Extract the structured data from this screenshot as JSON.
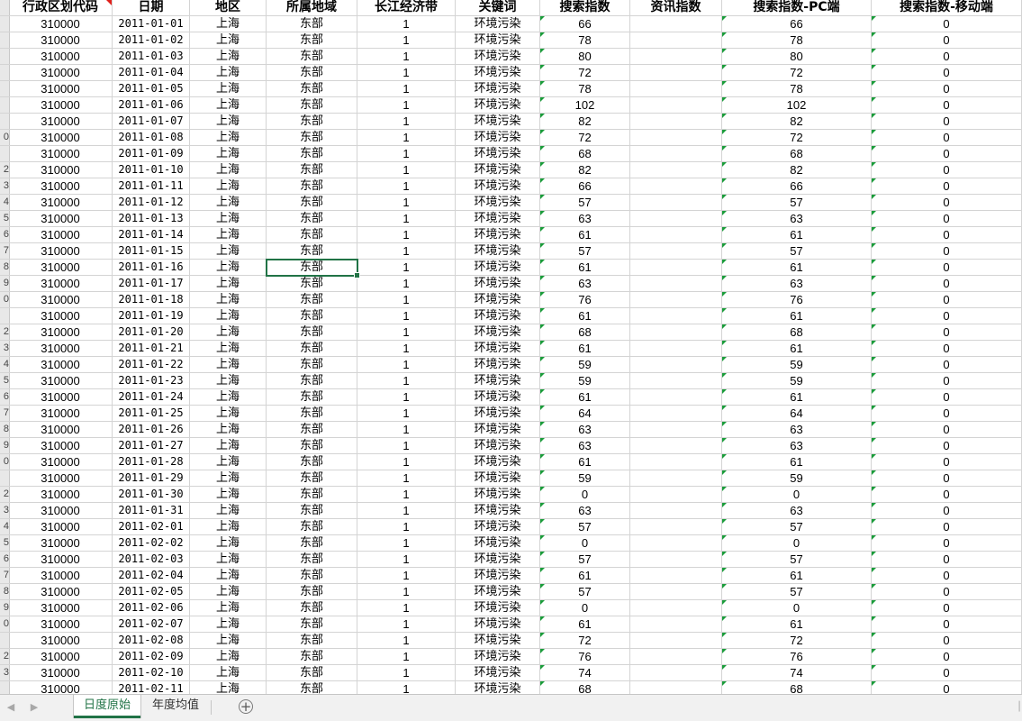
{
  "sheet": {
    "headers": [
      "行政区划代码",
      "日期",
      "地区",
      "所属地域",
      "长江经济带",
      "关键词",
      "搜索指数",
      "资讯指数",
      "搜索指数-PC端",
      "搜索指数-移动端"
    ],
    "row_numbers": [
      "",
      "",
      "",
      "",
      "",
      "",
      "",
      "",
      "0",
      "",
      "2",
      "3",
      "4",
      "5",
      "6",
      "7",
      "8",
      "9",
      "0",
      "",
      "2",
      "3",
      "4",
      "5",
      "6",
      "7",
      "8",
      "9",
      "0",
      "",
      "2",
      "3",
      "4",
      "5",
      "6",
      "7",
      "8",
      "9",
      "0",
      "",
      "2",
      "3"
    ],
    "rows": [
      [
        "310000",
        "2011-01-01",
        "上海",
        "东部",
        "1",
        "环境污染",
        "66",
        "",
        "66",
        "0"
      ],
      [
        "310000",
        "2011-01-02",
        "上海",
        "东部",
        "1",
        "环境污染",
        "78",
        "",
        "78",
        "0"
      ],
      [
        "310000",
        "2011-01-03",
        "上海",
        "东部",
        "1",
        "环境污染",
        "80",
        "",
        "80",
        "0"
      ],
      [
        "310000",
        "2011-01-04",
        "上海",
        "东部",
        "1",
        "环境污染",
        "72",
        "",
        "72",
        "0"
      ],
      [
        "310000",
        "2011-01-05",
        "上海",
        "东部",
        "1",
        "环境污染",
        "78",
        "",
        "78",
        "0"
      ],
      [
        "310000",
        "2011-01-06",
        "上海",
        "东部",
        "1",
        "环境污染",
        "102",
        "",
        "102",
        "0"
      ],
      [
        "310000",
        "2011-01-07",
        "上海",
        "东部",
        "1",
        "环境污染",
        "82",
        "",
        "82",
        "0"
      ],
      [
        "310000",
        "2011-01-08",
        "上海",
        "东部",
        "1",
        "环境污染",
        "72",
        "",
        "72",
        "0"
      ],
      [
        "310000",
        "2011-01-09",
        "上海",
        "东部",
        "1",
        "环境污染",
        "68",
        "",
        "68",
        "0"
      ],
      [
        "310000",
        "2011-01-10",
        "上海",
        "东部",
        "1",
        "环境污染",
        "82",
        "",
        "82",
        "0"
      ],
      [
        "310000",
        "2011-01-11",
        "上海",
        "东部",
        "1",
        "环境污染",
        "66",
        "",
        "66",
        "0"
      ],
      [
        "310000",
        "2011-01-12",
        "上海",
        "东部",
        "1",
        "环境污染",
        "57",
        "",
        "57",
        "0"
      ],
      [
        "310000",
        "2011-01-13",
        "上海",
        "东部",
        "1",
        "环境污染",
        "63",
        "",
        "63",
        "0"
      ],
      [
        "310000",
        "2011-01-14",
        "上海",
        "东部",
        "1",
        "环境污染",
        "61",
        "",
        "61",
        "0"
      ],
      [
        "310000",
        "2011-01-15",
        "上海",
        "东部",
        "1",
        "环境污染",
        "57",
        "",
        "57",
        "0"
      ],
      [
        "310000",
        "2011-01-16",
        "上海",
        "东部",
        "1",
        "环境污染",
        "61",
        "",
        "61",
        "0"
      ],
      [
        "310000",
        "2011-01-17",
        "上海",
        "东部",
        "1",
        "环境污染",
        "63",
        "",
        "63",
        "0"
      ],
      [
        "310000",
        "2011-01-18",
        "上海",
        "东部",
        "1",
        "环境污染",
        "76",
        "",
        "76",
        "0"
      ],
      [
        "310000",
        "2011-01-19",
        "上海",
        "东部",
        "1",
        "环境污染",
        "61",
        "",
        "61",
        "0"
      ],
      [
        "310000",
        "2011-01-20",
        "上海",
        "东部",
        "1",
        "环境污染",
        "68",
        "",
        "68",
        "0"
      ],
      [
        "310000",
        "2011-01-21",
        "上海",
        "东部",
        "1",
        "环境污染",
        "61",
        "",
        "61",
        "0"
      ],
      [
        "310000",
        "2011-01-22",
        "上海",
        "东部",
        "1",
        "环境污染",
        "59",
        "",
        "59",
        "0"
      ],
      [
        "310000",
        "2011-01-23",
        "上海",
        "东部",
        "1",
        "环境污染",
        "59",
        "",
        "59",
        "0"
      ],
      [
        "310000",
        "2011-01-24",
        "上海",
        "东部",
        "1",
        "环境污染",
        "61",
        "",
        "61",
        "0"
      ],
      [
        "310000",
        "2011-01-25",
        "上海",
        "东部",
        "1",
        "环境污染",
        "64",
        "",
        "64",
        "0"
      ],
      [
        "310000",
        "2011-01-26",
        "上海",
        "东部",
        "1",
        "环境污染",
        "63",
        "",
        "63",
        "0"
      ],
      [
        "310000",
        "2011-01-27",
        "上海",
        "东部",
        "1",
        "环境污染",
        "63",
        "",
        "63",
        "0"
      ],
      [
        "310000",
        "2011-01-28",
        "上海",
        "东部",
        "1",
        "环境污染",
        "61",
        "",
        "61",
        "0"
      ],
      [
        "310000",
        "2011-01-29",
        "上海",
        "东部",
        "1",
        "环境污染",
        "59",
        "",
        "59",
        "0"
      ],
      [
        "310000",
        "2011-01-30",
        "上海",
        "东部",
        "1",
        "环境污染",
        "0",
        "",
        "0",
        "0"
      ],
      [
        "310000",
        "2011-01-31",
        "上海",
        "东部",
        "1",
        "环境污染",
        "63",
        "",
        "63",
        "0"
      ],
      [
        "310000",
        "2011-02-01",
        "上海",
        "东部",
        "1",
        "环境污染",
        "57",
        "",
        "57",
        "0"
      ],
      [
        "310000",
        "2011-02-02",
        "上海",
        "东部",
        "1",
        "环境污染",
        "0",
        "",
        "0",
        "0"
      ],
      [
        "310000",
        "2011-02-03",
        "上海",
        "东部",
        "1",
        "环境污染",
        "57",
        "",
        "57",
        "0"
      ],
      [
        "310000",
        "2011-02-04",
        "上海",
        "东部",
        "1",
        "环境污染",
        "61",
        "",
        "61",
        "0"
      ],
      [
        "310000",
        "2011-02-05",
        "上海",
        "东部",
        "1",
        "环境污染",
        "57",
        "",
        "57",
        "0"
      ],
      [
        "310000",
        "2011-02-06",
        "上海",
        "东部",
        "1",
        "环境污染",
        "0",
        "",
        "0",
        "0"
      ],
      [
        "310000",
        "2011-02-07",
        "上海",
        "东部",
        "1",
        "环境污染",
        "61",
        "",
        "61",
        "0"
      ],
      [
        "310000",
        "2011-02-08",
        "上海",
        "东部",
        "1",
        "环境污染",
        "72",
        "",
        "72",
        "0"
      ],
      [
        "310000",
        "2011-02-09",
        "上海",
        "东部",
        "1",
        "环境污染",
        "76",
        "",
        "76",
        "0"
      ],
      [
        "310000",
        "2011-02-10",
        "上海",
        "东部",
        "1",
        "环境污染",
        "74",
        "",
        "74",
        "0"
      ],
      [
        "310000",
        "2011-02-11",
        "上海",
        "东部",
        "1",
        "环境污染",
        "68",
        "",
        "68",
        "0"
      ]
    ]
  },
  "tabs": {
    "sheet1": "日度原始",
    "sheet2": "年度均值",
    "add": "+"
  },
  "colors": {
    "accent": "#217346",
    "error_triangle": "#1a9c3a",
    "comment_marker": "#e0201b"
  }
}
